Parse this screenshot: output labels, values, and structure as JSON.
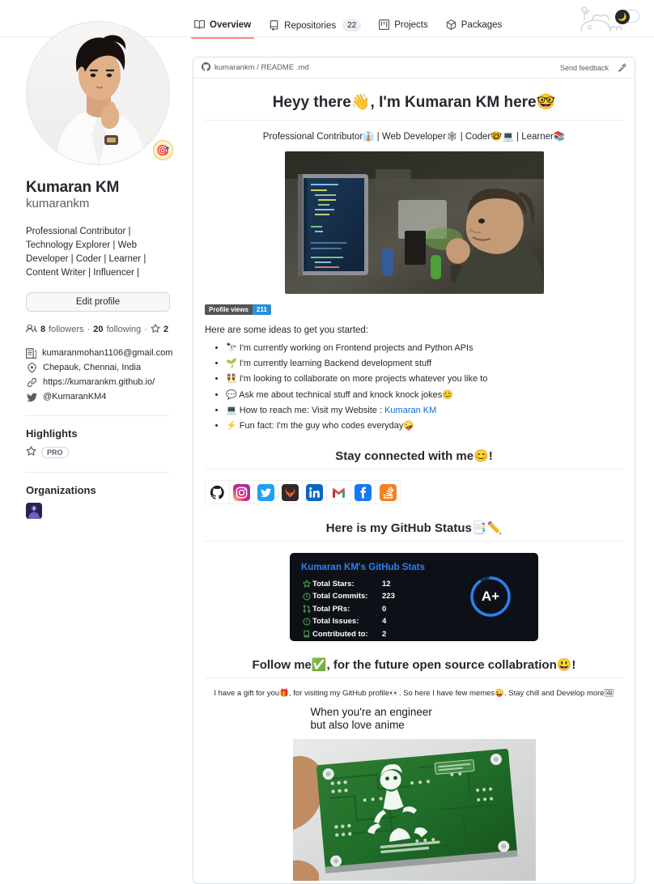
{
  "nav": {
    "tabs": [
      {
        "label": "Overview",
        "icon": "book-icon",
        "count": null,
        "active": true
      },
      {
        "label": "Repositories",
        "icon": "repo-icon",
        "count": "22",
        "active": false
      },
      {
        "label": "Projects",
        "icon": "project-icon",
        "count": null,
        "active": false
      },
      {
        "label": "Packages",
        "icon": "package-icon",
        "count": null,
        "active": false
      }
    ],
    "dark_mode_icon": "moon-icon",
    "decoration_icon": "octocat-icon"
  },
  "sidebar": {
    "avatar_alt": "Kumaran KM profile photo",
    "status_emoji": "🎯",
    "fullname": "Kumaran KM",
    "username": "kumarankm",
    "bio": "Professional Contributor | Technology Explorer | Web Developer | Coder | Learner | Content Writer | Influencer |",
    "edit_profile_label": "Edit profile",
    "followers": "8",
    "followers_label": "followers",
    "following": "20",
    "following_label": "following",
    "stars": "2",
    "separator": "·",
    "details": [
      {
        "icon": "org-building-icon",
        "text": "kumaranmohan1106@gmail.com"
      },
      {
        "icon": "location-icon",
        "text": "Chepauk, Chennai, India"
      },
      {
        "icon": "link-icon",
        "text": "https://kumarankm.github.io/"
      },
      {
        "icon": "twitter-icon",
        "text": "@KumaranKM4"
      }
    ],
    "highlights_title": "Highlights",
    "highlight_badge": "PRO",
    "highlight_icon": "star-icon",
    "organizations_title": "Organizations",
    "org_alt": "organization avatar"
  },
  "readme": {
    "repo_path": "kumarankm / README .md",
    "repo_icon": "octocat-icon",
    "feedback_label": "Send feedback",
    "edit_icon": "pencil-icon",
    "heading": "Heyy there👋, I'm Kumaran KM here🤓",
    "subline": "Professional Contributor👔 | Web Developer🕸 | Coder🤓💻 | Learner📚",
    "hero_alt": "programmer coding at monitor",
    "views_label": "Profile views",
    "views_count": "211",
    "ideas_intro": "Here are some ideas to get you started:",
    "bullets": [
      {
        "emoji": "🔭",
        "text": "I'm currently working on Frontend projects and Python APIs"
      },
      {
        "emoji": "🌱",
        "text": "I'm currently learning Backend development stuff"
      },
      {
        "emoji": "👯",
        "text": "I'm looking to collaborate on more projects whatever you like to"
      },
      {
        "emoji": "💬",
        "text": "Ask me about technical stuff and knock knock jokes😊"
      },
      {
        "emoji": "💻",
        "text": "How to reach me: Visit my Website : ",
        "link": "Kumaran KM"
      },
      {
        "emoji": "⚡",
        "text": "Fun fact: I'm the guy who codes everyday🤪"
      }
    ],
    "connect_heading": "Stay connected with me😊!",
    "social": [
      {
        "name": "github-icon",
        "label": "GitHub"
      },
      {
        "name": "instagram-icon",
        "label": "Instagram"
      },
      {
        "name": "twitter-icon",
        "label": "Twitter"
      },
      {
        "name": "gitlab-icon",
        "label": "GitLab"
      },
      {
        "name": "linkedin-icon",
        "label": "LinkedIn"
      },
      {
        "name": "gmail-icon",
        "label": "Gmail"
      },
      {
        "name": "facebook-icon",
        "label": "Facebook"
      },
      {
        "name": "stackoverflow-icon",
        "label": "Stack Overflow"
      }
    ],
    "status_heading": "Here is my GitHub Status📑✏️",
    "follow_heading": "Follow me✅, for the future open source collabration😃!",
    "gift_line": "I have a gift for you🎁, for visiting my GitHub profile👀. So here I have few memes😜. Stay chill and Develop more🖼",
    "meme_caption_line1": "When you're an engineer",
    "meme_caption_line2": "but also love anime",
    "meme_alt": "green PCB board with anime silkscreen art"
  },
  "stats_card": {
    "title": "Kumaran KM's GitHub Stats",
    "rows": [
      {
        "icon": "star-icon",
        "label": "Total Stars:",
        "value": "12"
      },
      {
        "icon": "clock-icon",
        "label": "Total Commits:",
        "value": "223"
      },
      {
        "icon": "pull-request-icon",
        "label": "Total PRs:",
        "value": "0"
      },
      {
        "icon": "issue-icon",
        "label": "Total Issues:",
        "value": "4"
      },
      {
        "icon": "repo-icon",
        "label": "Contributed to:",
        "value": "2"
      }
    ],
    "rank": "A+",
    "bg_color": "#0d1117",
    "title_color": "#2f80ed",
    "icon_color": "#4caf50",
    "ring_color": "#2f80ed"
  }
}
